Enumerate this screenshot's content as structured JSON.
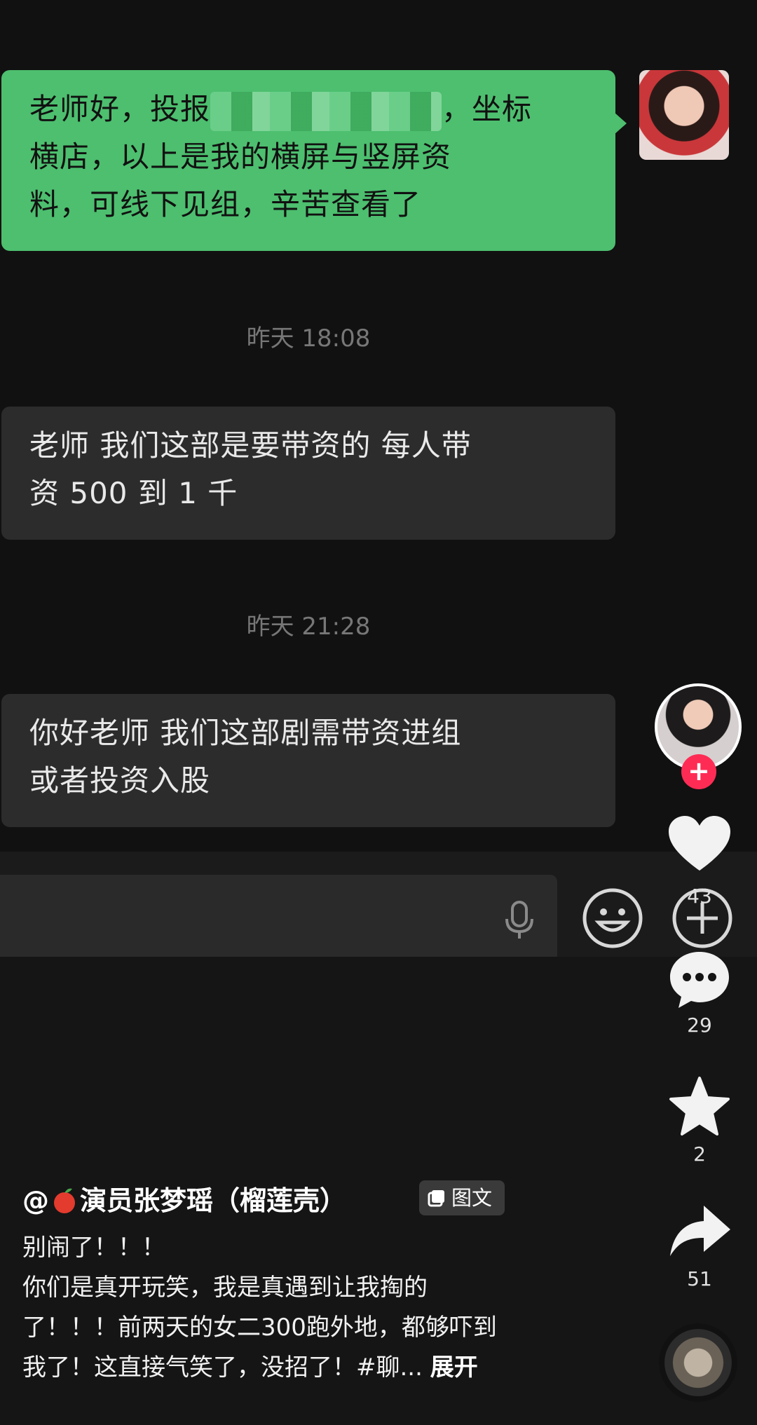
{
  "chat": {
    "messages": [
      {
        "line1_a": "老师好，投报",
        "line1_b": "坐标",
        "line2": "横店，以上是我的横屏与竖屏资",
        "line3": "料，可线下见组，辛苦查看了"
      },
      {
        "line1": "老师 我们这部是要带资的 每人带",
        "line2": "资 500 到 1 千"
      },
      {
        "line1": "你好老师 我们这部剧需带资进组",
        "line2": "或者投资入股"
      }
    ],
    "timestamps": [
      "昨天 18:08",
      "昨天 21:28"
    ]
  },
  "sidebar": {
    "likes": "43",
    "comments": "29",
    "favorites": "2",
    "shares": "51",
    "follow": "+"
  },
  "post": {
    "at": "@",
    "author": "演员张梦瑶（榴莲壳）",
    "badge": "图文",
    "caption_l1": "别闹了！！！",
    "caption_l2": "你们是真开玩笑，我是真遇到让我掏的",
    "caption_l3": "了！！！前两天的女二300跑外地，都够吓到",
    "caption_l4": "我了！这直接气笑了，没招了！#聊...",
    "expand": "展开"
  },
  "colors": {
    "sent_bubble": "#4dbf6f",
    "recv_bubble": "#2c2c2c",
    "follow": "#fe2c55"
  }
}
